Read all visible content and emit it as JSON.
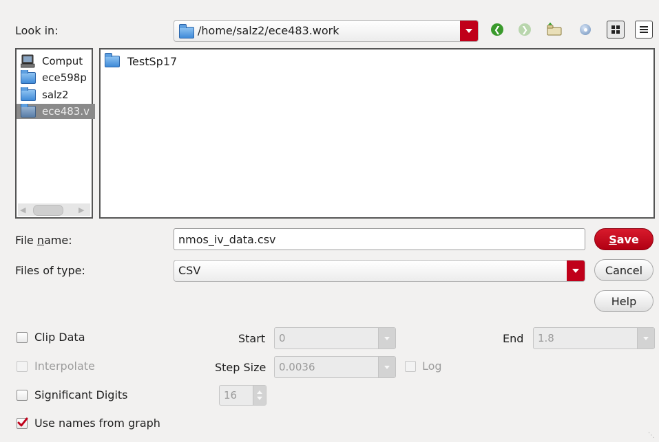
{
  "look_in": {
    "label": "Look in:",
    "path": "/home/salz2/ece483.work"
  },
  "toolbar": {
    "back_icon": "back-arrow-icon",
    "forward_icon": "forward-arrow-icon",
    "up_folder_icon": "parent-folder-icon",
    "new_folder_icon": "new-folder-icon",
    "list_view_icon": "list-view-icon",
    "details_view_icon": "details-view-icon"
  },
  "sidebar": {
    "items": [
      {
        "label": "Comput",
        "icon": "computer-icon",
        "selected": false
      },
      {
        "label": "ece598p",
        "icon": "folder-icon",
        "selected": false
      },
      {
        "label": "salz2",
        "icon": "folder-icon",
        "selected": false
      },
      {
        "label": "ece483.v",
        "icon": "folder-icon",
        "selected": true
      }
    ]
  },
  "files": {
    "items": [
      {
        "label": "TestSp17",
        "icon": "folder-icon"
      }
    ]
  },
  "file_name": {
    "label_pre": "File ",
    "label_mn": "n",
    "label_post": "ame:",
    "value": "nmos_iv_data.csv"
  },
  "file_type": {
    "label": "Files of type:",
    "value": "CSV"
  },
  "buttons": {
    "save_mn": "S",
    "save_rest": "ave",
    "cancel": "Cancel",
    "help": "Help"
  },
  "options": {
    "clip_data": {
      "label": "Clip Data",
      "checked": false
    },
    "start": {
      "label": "Start",
      "value": "0"
    },
    "end": {
      "label": "End",
      "value": "1.8"
    },
    "interpolate": {
      "label": "Interpolate",
      "checked": false,
      "enabled": false
    },
    "step_size": {
      "label": "Step Size",
      "value": "0.0036"
    },
    "log": {
      "label": "Log",
      "checked": false,
      "enabled": false
    },
    "significant_digits": {
      "label": "Significant Digits",
      "checked": false,
      "value": "16"
    },
    "use_names": {
      "label": "Use names from graph",
      "checked": true
    }
  },
  "colors": {
    "accent_red": "#c0001a",
    "dialog_bg": "#f2f1f0",
    "selection": "#8a8a8a"
  }
}
